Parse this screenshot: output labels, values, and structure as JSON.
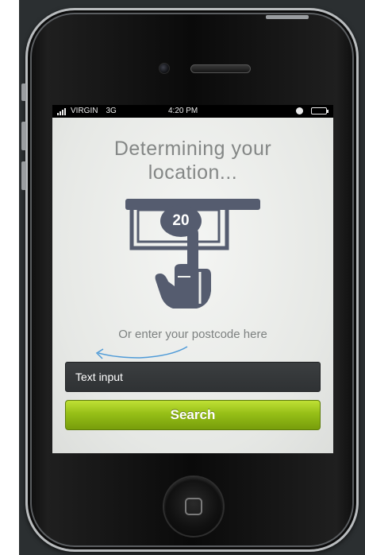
{
  "status_bar": {
    "carrier": "VIRGIN",
    "network": "3G",
    "time": "4:20 PM",
    "icons": [
      "signal-icon",
      "clock-icon",
      "battery-icon"
    ]
  },
  "screen": {
    "headline_line1": "Determining your",
    "headline_line2": "location...",
    "illustration": {
      "type": "atm-hand-illustration",
      "banknote_value": "20"
    },
    "postcode_hint": "Or enter your postcode here",
    "text_input_value": "Text input",
    "search_button_label": "Search"
  },
  "colors": {
    "headline": "#848786",
    "illustration": "#555c6f",
    "input_background": "#34373a",
    "search_button": "#96bf17",
    "hint_arrow": "#4f9bd8"
  }
}
